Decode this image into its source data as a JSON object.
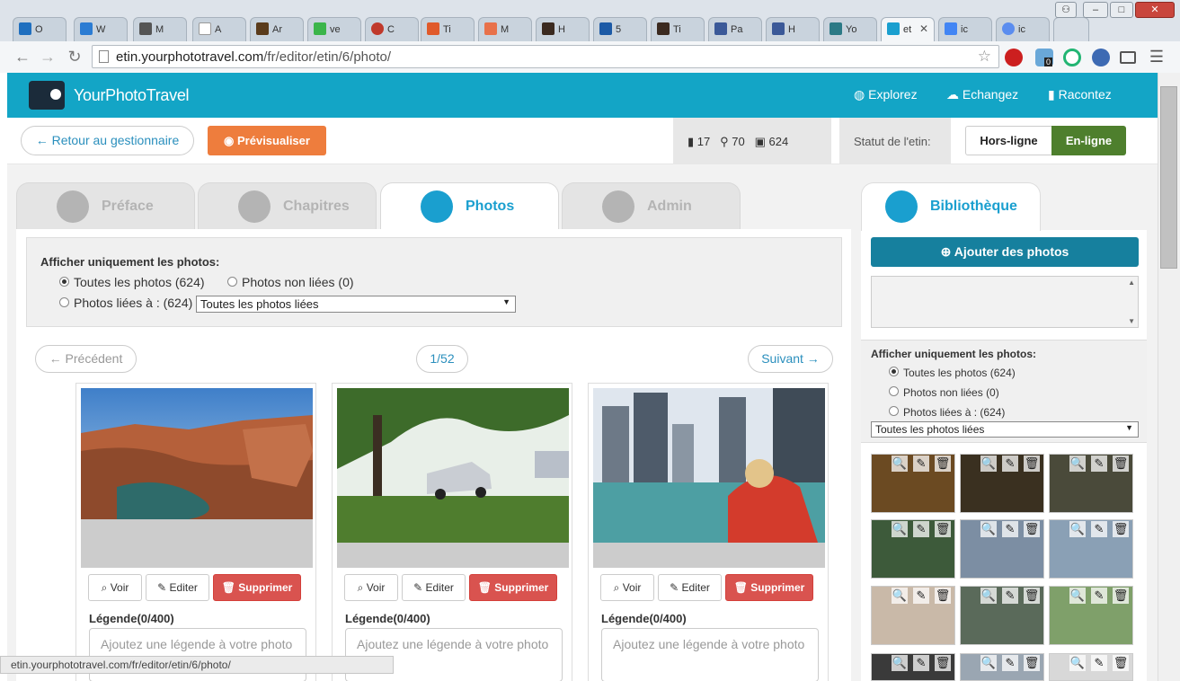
{
  "browser": {
    "tabs": [
      {
        "label": "O",
        "color": "#1f6fbf"
      },
      {
        "label": "W",
        "color": "#2b7cd3"
      },
      {
        "label": "M",
        "color": "#555555"
      },
      {
        "label": "A",
        "color": "#ffffff"
      },
      {
        "label": "Ar",
        "color": "#5a3b1b"
      },
      {
        "label": "ve",
        "color": "#3bb54a"
      },
      {
        "label": "C",
        "color": "#c0392b"
      },
      {
        "label": "Ti",
        "color": "#e05a2b"
      },
      {
        "label": "M",
        "color": "#e8714a"
      },
      {
        "label": "H",
        "color": "#3b2a20"
      },
      {
        "label": "5",
        "color": "#1c5aa6"
      },
      {
        "label": "Ti",
        "color": "#3b2a20"
      },
      {
        "label": "Pa",
        "color": "#3b5998"
      },
      {
        "label": "H",
        "color": "#3b5998"
      },
      {
        "label": "Yo",
        "color": "#2c7a86"
      },
      {
        "label": "et",
        "color": "#1a9fcf",
        "active": true
      },
      {
        "label": "ic",
        "color": "#4285f4"
      },
      {
        "label": "ic",
        "color": "#5b8def"
      }
    ],
    "url_host": "etin.yourphototravel.com",
    "url_path": "/fr/editor/etin/6/photo/",
    "window_buttons": {
      "min": "–",
      "max": "□",
      "close": "✕"
    },
    "ext_badge": "0",
    "status_url": "etin.yourphototravel.com/fr/editor/etin/6/photo/"
  },
  "site": {
    "brand": "YourPhotoTravel",
    "nav": {
      "explore": "Explorez",
      "exchange": "Echangez",
      "tell": "Racontez"
    },
    "back": "← Retour au gestionnaire",
    "preview": "Prévisualiser",
    "stats": {
      "chapters": "17",
      "places": "70",
      "photos": "624"
    },
    "status_label": "Statut de l'etin:",
    "offline": "Hors-ligne",
    "online": "En-ligne"
  },
  "tabs": {
    "preface": "Préface",
    "chapters": "Chapitres",
    "photos": "Photos",
    "admin": "Admin"
  },
  "filter": {
    "title": "Afficher uniquement les photos:",
    "all": "Toutes les photos (624)",
    "unlinked": "Photos non liées (0)",
    "linked": "Photos liées à : (624)",
    "select_value": "Toutes les photos liées"
  },
  "pagination": {
    "prev": "← Précédent",
    "page": "1/52",
    "next": "Suivant →"
  },
  "cards": {
    "view": "Voir",
    "edit": "Editer",
    "delete": "Supprimer",
    "legend_label": "Légende(0/400)",
    "legend_placeholder": "Ajoutez une légende à votre photo"
  },
  "library": {
    "title": "Bibliothèque",
    "add": "Ajouter des photos",
    "filter_title": "Afficher uniquement les photos:",
    "all": "Toutes les photos (624)",
    "unlinked": "Photos non liées (0)",
    "linked": "Photos liées à : (624)",
    "select_value": "Toutes les photos liées"
  },
  "icons": {
    "search": "🔍",
    "pencil": "✎",
    "trash": "🗑"
  }
}
